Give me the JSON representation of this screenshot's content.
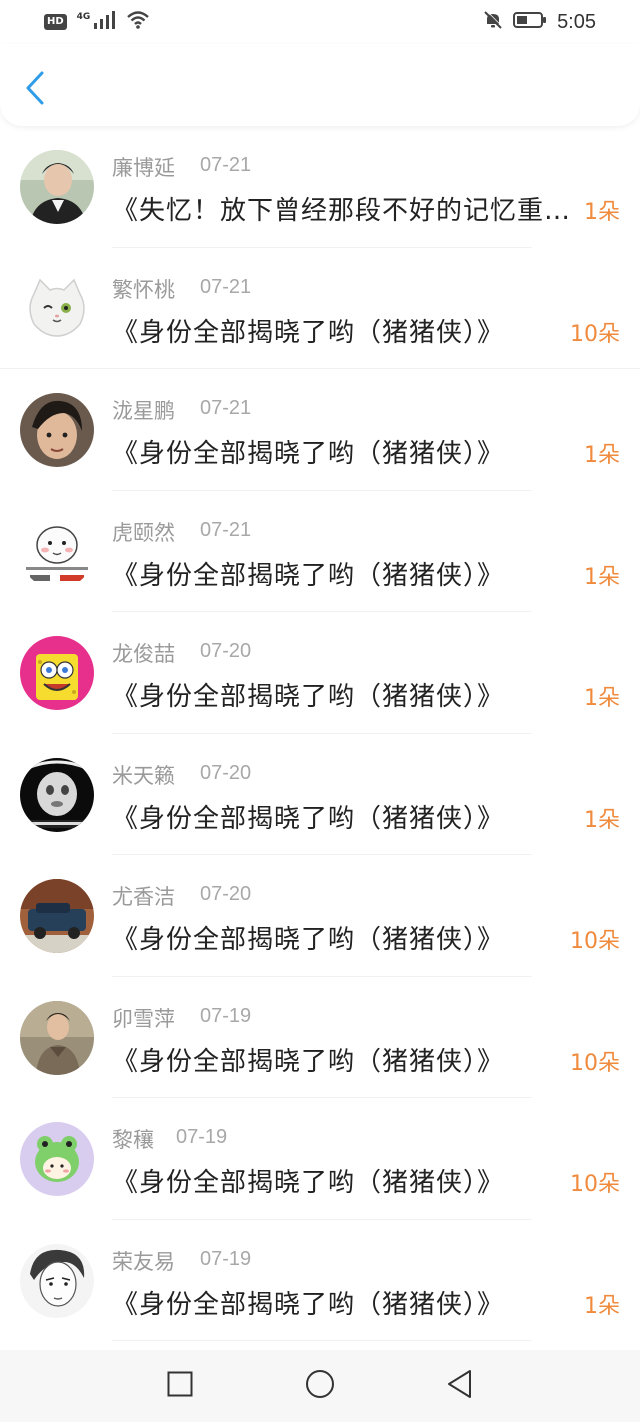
{
  "status_bar": {
    "network_badge": "HD",
    "network_type": "4G",
    "time": "5:05",
    "icons": [
      "signal-icon",
      "wifi-icon",
      "mute-icon",
      "battery-icon"
    ]
  },
  "header": {
    "back_icon": "back-chevron-icon"
  },
  "colors": {
    "accent": "#2f9ce8",
    "count": "#f08a3c",
    "muted_text": "#9a9a9a"
  },
  "list": [
    {
      "name": "廉博延",
      "date": "07-21",
      "title": "《失忆！放下曾经那段不好的记忆重新开始",
      "count": "1朵"
    },
    {
      "name": "繁怀桃",
      "date": "07-21",
      "title": "《身份全部揭晓了哟（猪猪侠）》",
      "count": "10朵"
    },
    {
      "name": "泷星鹏",
      "date": "07-21",
      "title": "《身份全部揭晓了哟（猪猪侠）》",
      "count": "1朵"
    },
    {
      "name": "虎颐然",
      "date": "07-21",
      "title": "《身份全部揭晓了哟（猪猪侠）》",
      "count": "1朵"
    },
    {
      "name": "龙俊喆",
      "date": "07-20",
      "title": "《身份全部揭晓了哟（猪猪侠）》",
      "count": "1朵"
    },
    {
      "name": "米天籁",
      "date": "07-20",
      "title": "《身份全部揭晓了哟（猪猪侠）》",
      "count": "1朵"
    },
    {
      "name": "尤香洁",
      "date": "07-20",
      "title": "《身份全部揭晓了哟（猪猪侠）》",
      "count": "10朵"
    },
    {
      "name": "卯雪萍",
      "date": "07-19",
      "title": "《身份全部揭晓了哟（猪猪侠）》",
      "count": "10朵"
    },
    {
      "name": "黎穰",
      "date": "07-19",
      "title": "《身份全部揭晓了哟（猪猪侠）》",
      "count": "10朵"
    },
    {
      "name": "荣友易",
      "date": "07-19",
      "title": "《身份全部揭晓了哟（猪猪侠）》",
      "count": "1朵"
    }
  ],
  "nav_bar": {
    "icons": [
      "recent-apps-icon",
      "home-icon",
      "back-triangle-icon"
    ]
  }
}
